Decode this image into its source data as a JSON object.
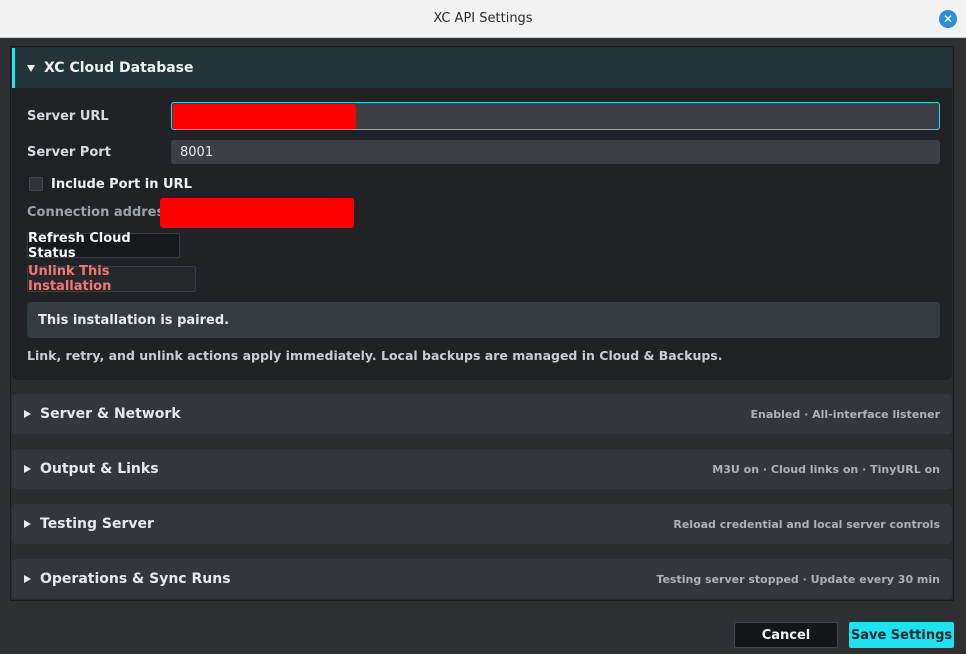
{
  "window": {
    "title": "XC API Settings"
  },
  "cloud": {
    "header": "XC Cloud Database",
    "server_url_label": "Server URL",
    "server_port_label": "Server Port",
    "server_port_value": "8001",
    "include_port_label": "Include Port in URL",
    "include_port_checked": false,
    "connection_label": "Connection address:",
    "refresh_label": "Refresh Cloud Status",
    "unlink_label": "Unlink This Installation",
    "status": "This installation is paired.",
    "note": "Link, retry, and unlink actions apply immediately. Local backups are managed in Cloud & Backups."
  },
  "sections": [
    {
      "title": "Server & Network",
      "summary": "Enabled · All-interface listener"
    },
    {
      "title": "Output & Links",
      "summary": "M3U on · Cloud links on · TinyURL on"
    },
    {
      "title": "Testing Server",
      "summary": "Reload credential and local server controls"
    },
    {
      "title": "Operations & Sync Runs",
      "summary": "Testing server stopped · Update every 30 min"
    }
  ],
  "footer": {
    "cancel": "Cancel",
    "save": "Save Settings"
  },
  "colors": {
    "accent": "#1ee2ef",
    "danger": "#f17878"
  }
}
